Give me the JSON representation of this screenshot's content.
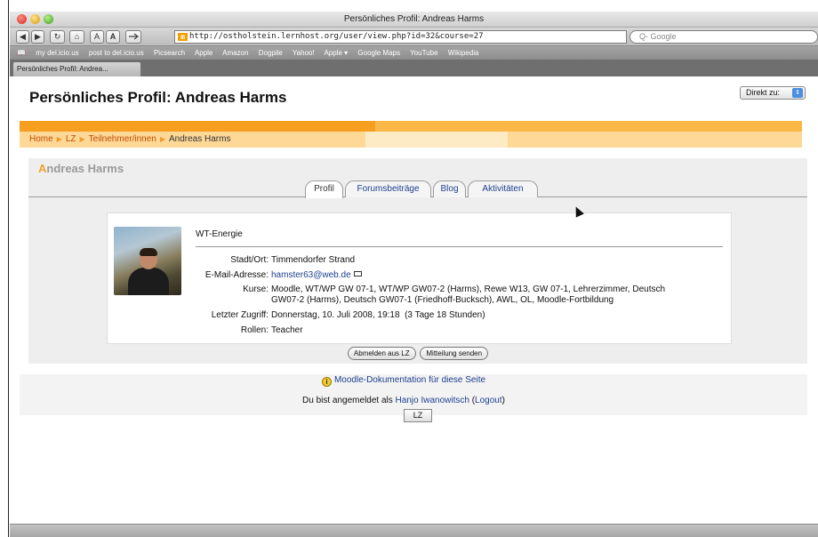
{
  "browser": {
    "window_title": "Persönliches Profil: Andreas Harms",
    "url": "http://ostholstein.lernhost.org/user/view.php?id=32&course=27",
    "search_placeholder": "Q- Google",
    "nav_buttons": [
      "◀",
      "▶",
      "↻",
      "⌂",
      "A",
      "A"
    ],
    "bookmarks": [
      "my del.icio.us",
      "post to del.icio.us",
      "Picsearch",
      "Apple",
      "Amazon",
      "Dogpile",
      "Yahoo!",
      "Apple ▾",
      "Google Maps",
      "YouTube",
      "Wikipedia"
    ],
    "tab_label": "Persönliches Profil: Andrea..."
  },
  "page": {
    "title": "Persönliches Profil: Andreas Harms",
    "jump_label": "Direkt zu:",
    "breadcrumb": {
      "home": "Home",
      "course": "LZ",
      "participants": "Teilnehmer/innen",
      "current": "Andreas Harms"
    },
    "user_first": "A",
    "user_rest": "ndreas Harms",
    "tabs": [
      "Profil",
      "Forumsbeiträge",
      "Blog",
      "Aktivitäten"
    ],
    "profile": {
      "org": "WT-Energie",
      "city_label": "Stadt/Ort:",
      "city": "Timmendorfer Strand",
      "email_label": "E-Mail-Adresse:",
      "email": "hamster63@web.de",
      "courses_label": "Kurse:",
      "courses_line1": "Moodle, WT/WP GW 07-1, WT/WP GW07-2 (Harms), Rewe W13, GW 07-1, Lehrerzimmer, Deutsch",
      "courses_line2": "GW07-2 (Harms), Deutsch GW07-1 (Friedhoff-Bucksch), AWL, OL, Moodle-Fortbildung",
      "access_label": "Letzter Zugriff:",
      "access": "Donnerstag, 10. Juli 2008, 19:18  (3 Tage 18 Stunden)",
      "roles_label": "Rollen:",
      "roles": "Teacher"
    },
    "buttons": {
      "unenrol": "Abmelden aus LZ",
      "message": "Mitteilung senden"
    },
    "footer": {
      "doc_link": "Moodle-Dokumentation für diese Seite",
      "logged_prefix": "Du bist angemeldet als",
      "logged_user": "Hanjo Iwanowitsch",
      "logout": "Logout",
      "course_button": "LZ"
    }
  },
  "colors": {
    "accent_orange": "#f59e1f",
    "link_blue": "#1d3f8f"
  }
}
